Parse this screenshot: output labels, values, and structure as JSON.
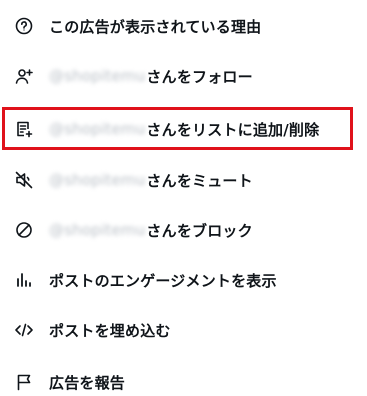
{
  "menu": {
    "items": [
      {
        "name": "ad-info-item",
        "icon": "question-circle-icon",
        "label": "この広告が表示されている理由",
        "handle": ""
      },
      {
        "name": "follow-item",
        "icon": "person-add-icon",
        "label": "さんをフォロー",
        "handle": "@shopitemu"
      },
      {
        "name": "add-to-list-item",
        "icon": "list-add-icon",
        "label": "さんをリストに追加/削除",
        "handle": "@shopitemu"
      },
      {
        "name": "mute-item",
        "icon": "speaker-mute-icon",
        "label": "さんをミュート",
        "handle": "@shopitemu"
      },
      {
        "name": "block-item",
        "icon": "block-icon",
        "label": "さんをブロック",
        "handle": "@shopitemu"
      },
      {
        "name": "engagement-item",
        "icon": "bar-chart-icon",
        "label": "ポストのエンゲージメントを表示",
        "handle": ""
      },
      {
        "name": "embed-item",
        "icon": "code-icon",
        "label": "ポストを埋め込む",
        "handle": ""
      },
      {
        "name": "report-ad-item",
        "icon": "flag-icon",
        "label": "広告を報告",
        "handle": ""
      }
    ]
  },
  "highlight": {
    "target": "add-to-list-item",
    "color": "#e0121b"
  }
}
